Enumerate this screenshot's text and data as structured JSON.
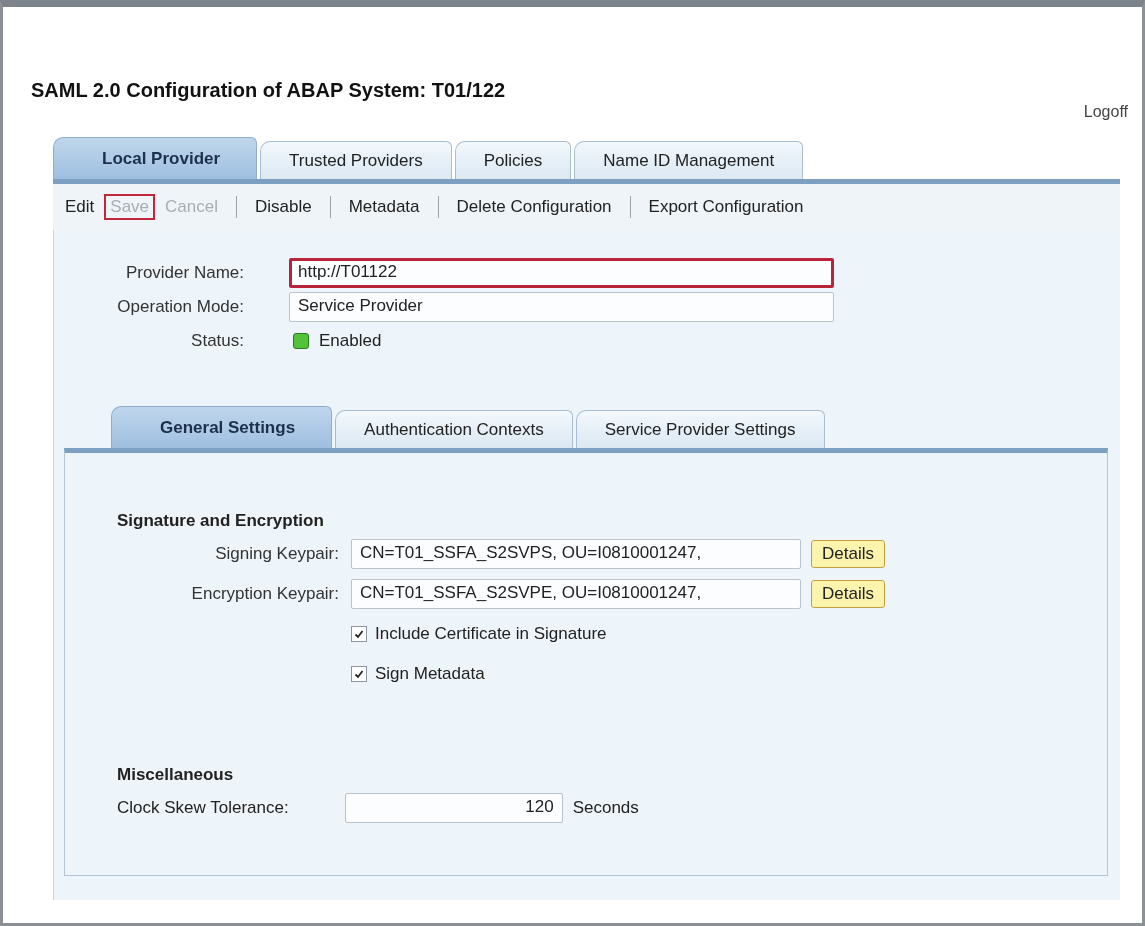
{
  "page": {
    "title": "SAML 2.0 Configuration of ABAP System: T01/122",
    "logoff": "Logoff"
  },
  "tabs": [
    {
      "label": "Local Provider",
      "selected": true
    },
    {
      "label": "Trusted Providers",
      "selected": false
    },
    {
      "label": "Policies",
      "selected": false
    },
    {
      "label": "Name ID Management",
      "selected": false
    }
  ],
  "toolbar": [
    {
      "label": "Edit",
      "disabled": false,
      "highlighted": false,
      "separator_before": false
    },
    {
      "label": "Save",
      "disabled": true,
      "highlighted": true,
      "separator_before": false
    },
    {
      "label": "Cancel",
      "disabled": true,
      "highlighted": false,
      "separator_before": false
    },
    {
      "label": "Disable",
      "disabled": false,
      "highlighted": false,
      "separator_before": true
    },
    {
      "label": "Metadata",
      "disabled": false,
      "highlighted": false,
      "separator_before": true
    },
    {
      "label": "Delete Configuration",
      "disabled": false,
      "highlighted": false,
      "separator_before": true
    },
    {
      "label": "Export Configuration",
      "disabled": false,
      "highlighted": false,
      "separator_before": true
    }
  ],
  "provider_fields": [
    {
      "label": "Provider Name:",
      "value": "http://T01122",
      "highlighted": true
    },
    {
      "label": "Operation Mode:",
      "value": "Service Provider",
      "highlighted": false
    }
  ],
  "status": {
    "label": "Status:",
    "value": "Enabled",
    "on": true
  },
  "sub_tabs": [
    {
      "label": "General Settings",
      "selected": true
    },
    {
      "label": "Authentication Contexts",
      "selected": false
    },
    {
      "label": "Service Provider Settings",
      "selected": false
    }
  ],
  "signature_section": {
    "heading": "Signature and Encryption",
    "keypairs": [
      {
        "label": "Signing Keypair:",
        "value": "CN=T01_SSFA_S2SVPS, OU=I0810001247,",
        "button": "Details"
      },
      {
        "label": "Encryption Keypair:",
        "value": "CN=T01_SSFA_S2SVPE, OU=I0810001247,",
        "button": "Details"
      }
    ],
    "options": [
      {
        "label": "Include Certificate in Signature",
        "checked": true
      },
      {
        "label": "Sign Metadata",
        "checked": true
      }
    ]
  },
  "misc_section": {
    "heading": "Miscellaneous",
    "label": "Clock Skew Tolerance:",
    "value": "120",
    "unit": "Seconds"
  }
}
